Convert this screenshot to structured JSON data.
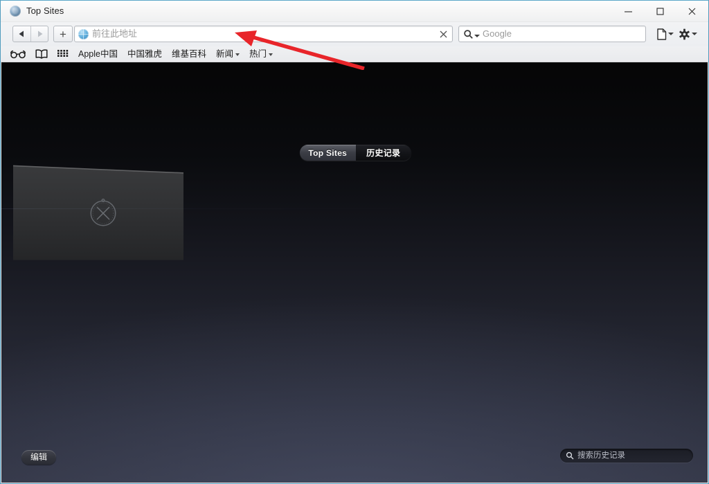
{
  "window": {
    "title": "Top Sites",
    "title_icon": "safari-compass-icon",
    "controls": {
      "minimize": "minimize-icon",
      "maximize": "maximize-icon",
      "close": "close-icon"
    },
    "border_color": "#4f9bbd"
  },
  "toolbar": {
    "back_label": "◀",
    "forward_label": "▶",
    "new_tab_label": "+",
    "address": {
      "value": "",
      "placeholder": "前往此地址",
      "clear_label": "✕",
      "icon": "globe-icon"
    },
    "search": {
      "value": "",
      "placeholder": "Google",
      "icon": "search-magnifier-icon"
    },
    "page_button": "page-actions-icon",
    "gear_button": "settings-gear-icon"
  },
  "bookmark_bar": {
    "icons": [
      {
        "name": "reader-glasses-icon"
      },
      {
        "name": "bookmarks-book-icon"
      },
      {
        "name": "top-sites-grid-icon"
      }
    ],
    "items": [
      {
        "label": "Apple中国",
        "has_menu": false
      },
      {
        "label": "中国雅虎",
        "has_menu": false
      },
      {
        "label": "维基百科",
        "has_menu": false
      },
      {
        "label": "新闻",
        "has_menu": true
      },
      {
        "label": "热门",
        "has_menu": true
      }
    ]
  },
  "content": {
    "segmented": {
      "top_sites": "Top Sites",
      "history": "历史记录",
      "selected": "Top Sites"
    },
    "thumbnail": {
      "icon": "safari-compass-placeholder-icon",
      "title": ""
    },
    "edit_button": "编辑",
    "history_search": {
      "value": "",
      "placeholder": "搜索历史记录",
      "icon": "search-magnifier-icon"
    },
    "background_top_color": "#050506",
    "background_bottom_color": "#313443"
  },
  "annotation": {
    "arrow_color": "#e8252a",
    "type": "red-arrow",
    "points_to": "address-bar"
  }
}
